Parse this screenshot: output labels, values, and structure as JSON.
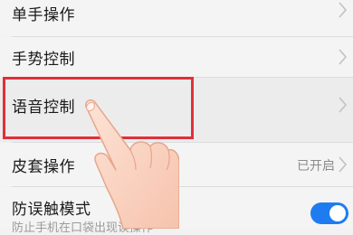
{
  "settings": {
    "rows": [
      {
        "label": "单手操作"
      },
      {
        "label": "手势控制"
      },
      {
        "label": "语音控制"
      },
      {
        "label": "皮套操作",
        "value": "已开启"
      },
      {
        "label": "防误触模式",
        "sublabel": "防止手机在口袋出现误操作",
        "toggle_on": true
      }
    ]
  },
  "colors": {
    "highlight_border": "#e0303a",
    "toggle_on": "#1f7cf0"
  },
  "icons": {
    "chevron": "chevron-right-icon",
    "pointer": "pointing-hand-icon"
  }
}
